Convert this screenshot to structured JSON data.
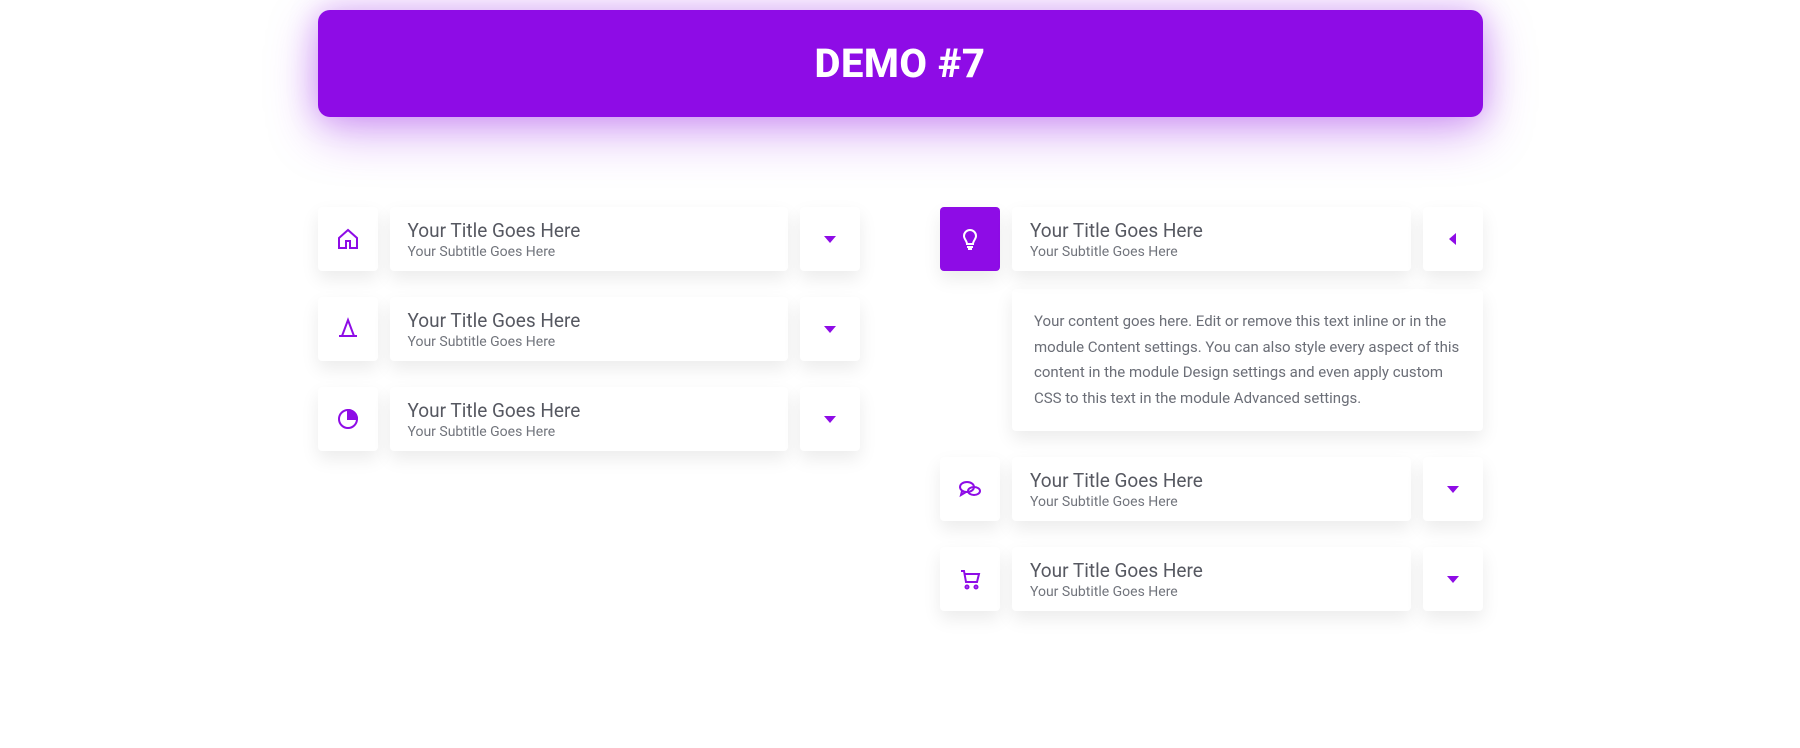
{
  "banner": {
    "title": "DEMO #7"
  },
  "accent": "#8e0ce6",
  "left_items": [
    {
      "icon": "home",
      "title": "Your Title Goes Here",
      "subtitle": "Your Subtitle Goes Here",
      "open": false
    },
    {
      "icon": "cone",
      "title": "Your Title Goes Here",
      "subtitle": "Your Subtitle Goes Here",
      "open": false
    },
    {
      "icon": "chart",
      "title": "Your Title Goes Here",
      "subtitle": "Your Subtitle Goes Here",
      "open": false
    }
  ],
  "right_items": [
    {
      "icon": "bulb",
      "title": "Your Title Goes Here",
      "subtitle": "Your Subtitle Goes Here",
      "open": true,
      "content": "Your content goes here. Edit or remove this text inline or in the module Content settings. You can also style every aspect of this content in the module Design settings and even apply custom CSS to this text in the module Advanced settings."
    },
    {
      "icon": "chat",
      "title": "Your Title Goes Here",
      "subtitle": "Your Subtitle Goes Here",
      "open": false
    },
    {
      "icon": "cart",
      "title": "Your Title Goes Here",
      "subtitle": "Your Subtitle Goes Here",
      "open": false
    }
  ]
}
